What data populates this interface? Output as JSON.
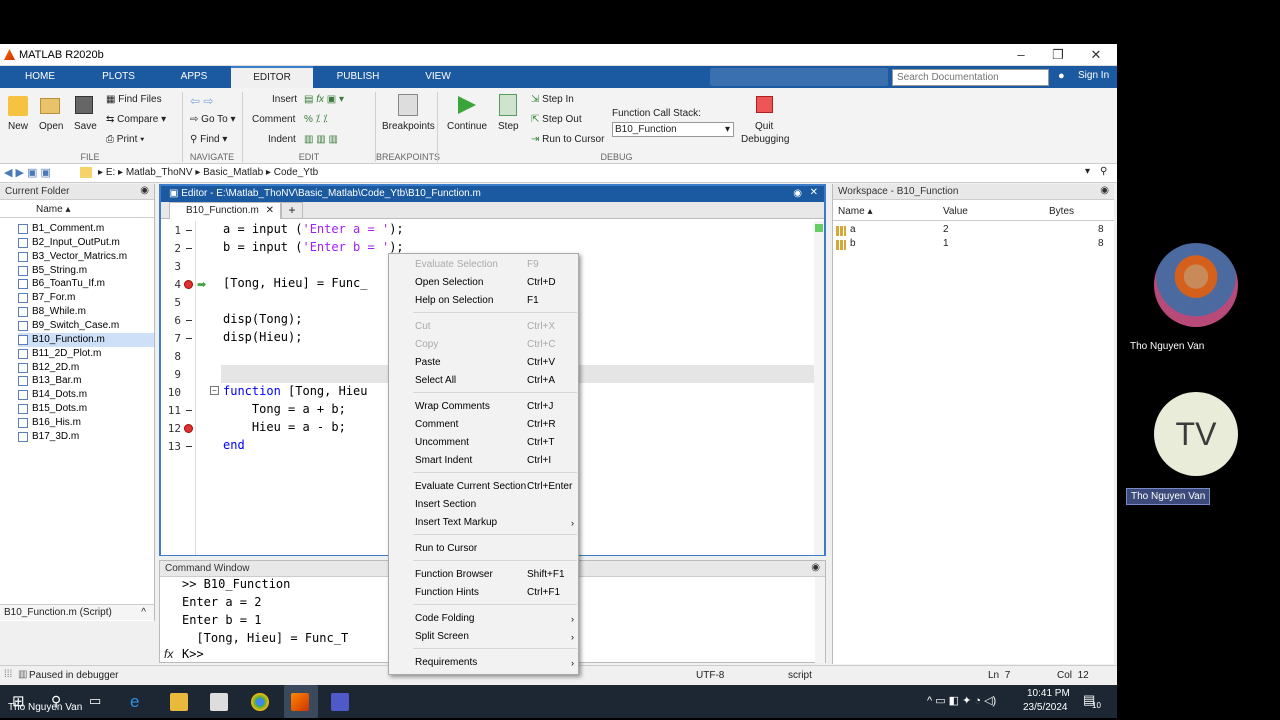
{
  "window": {
    "title": "MATLAB R2020b"
  },
  "tabs": [
    {
      "label": "HOME"
    },
    {
      "label": "PLOTS"
    },
    {
      "label": "APPS"
    },
    {
      "label": "EDITOR"
    },
    {
      "label": "PUBLISH"
    },
    {
      "label": "VIEW"
    }
  ],
  "search": {
    "placeholder": "Search Documentation"
  },
  "signin": "Sign In",
  "ribbon": {
    "new": "New",
    "open": "Open",
    "save": "Save",
    "file": "FILE",
    "find_files": "Find Files",
    "compare": "Compare",
    "print": "Print",
    "goto": "Go To",
    "find": "Find",
    "navigate": "NAVIGATE",
    "insert": "Insert",
    "comment": "Comment",
    "indent": "Indent",
    "edit": "EDIT",
    "breakpoints": "Breakpoints",
    "breakpoints_sec": "BREAKPOINTS",
    "continue": "Continue",
    "step": "Step",
    "step_in": "Step In",
    "step_out": "Step Out",
    "run_to_cursor": "Run to Cursor",
    "call_stack_label": "Function Call Stack:",
    "call_stack_value": "B10_Function",
    "quit": "Quit",
    "debugging": "Debugging",
    "debug": "DEBUG"
  },
  "address": [
    "E:",
    "Matlab_ThoNV",
    "Basic_Matlab",
    "Code_Ytb"
  ],
  "current_folder": {
    "title": "Current Folder",
    "col_name": "Name",
    "files": [
      "B1_Comment.m",
      "B2_Input_OutPut.m",
      "B3_Vector_Matrics.m",
      "B5_String.m",
      "B6_ToanTu_If.m",
      "B7_For.m",
      "B8_While.m",
      "B9_Switch_Case.m",
      "B10_Function.m",
      "B11_2D_Plot.m",
      "B12_2D.m",
      "B13_Bar.m",
      "B14_Dots.m",
      "B15_Dots.m",
      "B16_His.m",
      "B17_3D.m"
    ],
    "selected": "B10_Function.m",
    "details": "B10_Function.m (Script)"
  },
  "editor": {
    "title": "Editor - E:\\Matlab_ThoNV\\Basic_Matlab\\Code_Ytb\\B10_Function.m",
    "tab": "B10_Function.m",
    "plus": "+",
    "lines": [
      {
        "n": "1",
        "parts": [
          {
            "t": "a = input (",
            "c": "#000"
          },
          {
            "t": "'Enter a = '",
            "c": "#a020f0"
          },
          {
            "t": ");",
            "c": "#000"
          }
        ]
      },
      {
        "n": "2",
        "parts": [
          {
            "t": "b = input (",
            "c": "#000"
          },
          {
            "t": "'Enter b = '",
            "c": "#a020f0"
          },
          {
            "t": ");",
            "c": "#000"
          }
        ]
      },
      {
        "n": "3",
        "parts": []
      },
      {
        "n": "4",
        "parts": [
          {
            "t": "[Tong, Hieu] = Func_",
            "c": "#000"
          }
        ]
      },
      {
        "n": "5",
        "parts": []
      },
      {
        "n": "6",
        "parts": [
          {
            "t": "disp(Tong);",
            "c": "#000"
          }
        ]
      },
      {
        "n": "7",
        "parts": [
          {
            "t": "disp(Hieu);",
            "c": "#000"
          }
        ]
      },
      {
        "n": "8",
        "parts": []
      },
      {
        "n": "9",
        "parts": []
      },
      {
        "n": "10",
        "parts": [
          {
            "t": "function",
            "c": "#0000ff"
          },
          {
            "t": " [Tong, Hieu",
            "c": "#000"
          }
        ]
      },
      {
        "n": "11",
        "parts": [
          {
            "t": "    Tong = a + b;",
            "c": "#000"
          }
        ]
      },
      {
        "n": "12",
        "parts": [
          {
            "t": "    Hieu = a - b;",
            "c": "#000"
          }
        ]
      },
      {
        "n": "13",
        "parts": [
          {
            "t": "end",
            "c": "#0000ff"
          }
        ]
      }
    ]
  },
  "command_window": {
    "title": "Command Window",
    "lines": [
      ">> B10_Function",
      "Enter a = 2",
      "Enter b = 1",
      "  [Tong, Hieu] = Func_T"
    ],
    "prompt": "K>>",
    "fx": "fx"
  },
  "workspace": {
    "title": "Workspace - B10_Function",
    "cols": [
      "Name",
      "Value",
      "Bytes"
    ],
    "rows": [
      {
        "name": "a",
        "value": "2",
        "bytes": "8"
      },
      {
        "name": "b",
        "value": "1",
        "bytes": "8"
      }
    ]
  },
  "status": {
    "left": "Paused in debugger",
    "enc": "UTF-8",
    "type": "script",
    "ln_label": "Ln",
    "ln": "7",
    "col_label": "Col",
    "col": "12"
  },
  "context_menu": [
    {
      "label": "Evaluate Selection",
      "shortcut": "F9",
      "disabled": true
    },
    {
      "label": "Open Selection",
      "shortcut": "Ctrl+D"
    },
    {
      "label": "Help on Selection",
      "shortcut": "F1"
    },
    {
      "label": "Cut",
      "shortcut": "Ctrl+X",
      "disabled": true
    },
    {
      "label": "Copy",
      "shortcut": "Ctrl+C",
      "disabled": true
    },
    {
      "label": "Paste",
      "shortcut": "Ctrl+V"
    },
    {
      "label": "Select All",
      "shortcut": "Ctrl+A"
    },
    {
      "label": "Wrap Comments",
      "shortcut": "Ctrl+J"
    },
    {
      "label": "Comment",
      "shortcut": "Ctrl+R"
    },
    {
      "label": "Uncomment",
      "shortcut": "Ctrl+T"
    },
    {
      "label": "Smart Indent",
      "shortcut": "Ctrl+I"
    },
    {
      "label": "Evaluate Current Section",
      "shortcut": "Ctrl+Enter"
    },
    {
      "label": "Insert Section",
      "shortcut": ""
    },
    {
      "label": "Insert Text Markup",
      "shortcut": "",
      "submenu": true
    },
    {
      "label": "Run to Cursor",
      "shortcut": ""
    },
    {
      "label": "Function Browser",
      "shortcut": "Shift+F1"
    },
    {
      "label": "Function Hints",
      "shortcut": "Ctrl+F1"
    },
    {
      "label": "Code Folding",
      "shortcut": "",
      "submenu": true
    },
    {
      "label": "Split Screen",
      "shortcut": "",
      "submenu": true
    },
    {
      "label": "Requirements",
      "shortcut": "",
      "submenu": true
    }
  ],
  "taskbar": {
    "time": "10:41 PM",
    "date": "23/5/2024",
    "notif": "10"
  },
  "meeting": {
    "participant1": "Tho Nguyen Van",
    "participant2_initials": "TV",
    "participant2": "Tho Nguyen Van",
    "self_name": "Tho Nguyen Van"
  }
}
